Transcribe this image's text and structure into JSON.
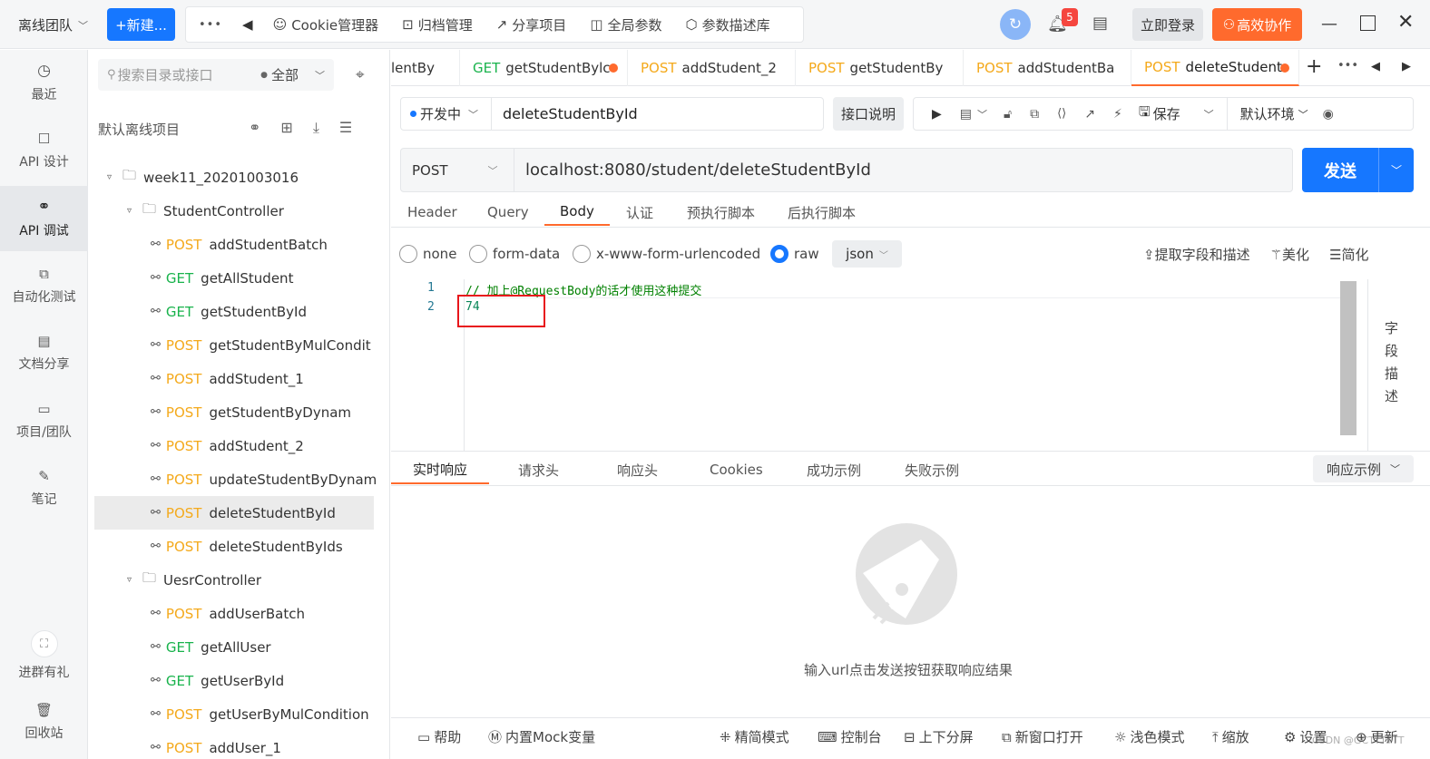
{
  "titlebar": {
    "team": "离线团队",
    "new_button": "+新建...",
    "more": "•••",
    "tools": [
      "Cookie管理器",
      "归档管理",
      "分享项目",
      "全局参数",
      "参数描述库"
    ],
    "notification_count": "5",
    "login": "立即登录",
    "collab": "高效协作"
  },
  "leftnav": {
    "items": [
      "最近",
      "API 设计",
      "API 调试",
      "自动化测试",
      "文档分享",
      "项目/团队",
      "笔记"
    ],
    "bottom": [
      "进群有礼",
      "回收站"
    ]
  },
  "tree": {
    "search_placeholder": "搜索目录或接口",
    "filter": "全部",
    "project_title": "默认离线项目",
    "root": "week11_20201003016",
    "folder1": "StudentController",
    "folder2": "UesrController",
    "items1": [
      {
        "method": "POST",
        "name": "addStudentBatch"
      },
      {
        "method": "GET",
        "name": "getAllStudent"
      },
      {
        "method": "GET",
        "name": "getStudentById"
      },
      {
        "method": "POST",
        "name": "getStudentByMulCondit"
      },
      {
        "method": "POST",
        "name": "addStudent_1"
      },
      {
        "method": "POST",
        "name": "getStudentByDynam"
      },
      {
        "method": "POST",
        "name": "addStudent_2"
      },
      {
        "method": "POST",
        "name": "updateStudentByDynam"
      },
      {
        "method": "POST",
        "name": "deleteStudentById"
      },
      {
        "method": "POST",
        "name": "deleteStudentByIds"
      }
    ],
    "items2": [
      {
        "method": "POST",
        "name": "addUserBatch"
      },
      {
        "method": "GET",
        "name": "getAllUser"
      },
      {
        "method": "GET",
        "name": "getUserById"
      },
      {
        "method": "POST",
        "name": "getUserByMulCondition"
      },
      {
        "method": "POST",
        "name": "addUser_1"
      }
    ]
  },
  "tabs": [
    {
      "method": "",
      "name": "lentBy"
    },
    {
      "method": "GET",
      "name": "getStudentBylc"
    },
    {
      "method": "POST",
      "name": "addStudent_2"
    },
    {
      "method": "POST",
      "name": "getStudentBy"
    },
    {
      "method": "POST",
      "name": "addStudentBa"
    },
    {
      "method": "POST",
      "name": "deleteStudent"
    }
  ],
  "api": {
    "status": "开发中",
    "name": "deleteStudentById",
    "doc_button": "接口说明",
    "save": "保存",
    "env": "默认环境",
    "method": "POST",
    "url": "localhost:8080/student/deleteStudentById",
    "send": "发送"
  },
  "req_tabs": [
    "Header",
    "Query",
    "Body",
    "认证",
    "预执行脚本",
    "后执行脚本"
  ],
  "body_types": [
    "none",
    "form-data",
    "x-www-form-urlencoded",
    "raw"
  ],
  "body_format": "json",
  "body_actions": [
    "提取字段和描述",
    "美化",
    "简化"
  ],
  "editor": {
    "lines": [
      "// 加上@RequestBody的话才使用这种提交",
      "74"
    ],
    "side_label": "字段描述"
  },
  "resp_tabs": [
    "实时响应",
    "请求头",
    "响应头",
    "Cookies",
    "成功示例",
    "失败示例"
  ],
  "resp_example": "响应示例",
  "resp_empty": "输入url点击发送按钮获取响应结果",
  "statusbar": [
    "帮助",
    "内置Mock变量",
    "精简模式",
    "控制台",
    "上下分屏",
    "新窗口打开",
    "浅色模式",
    "缩放",
    "设置",
    "更新"
  ],
  "watermark": "CSDN @GCTTTTTT"
}
